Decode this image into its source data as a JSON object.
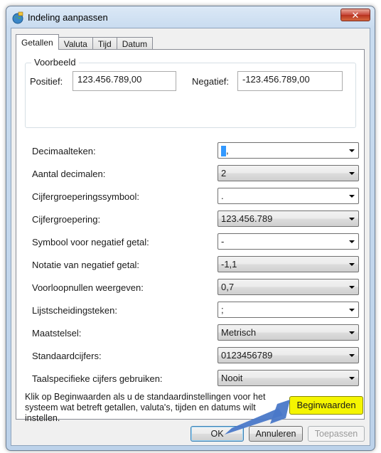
{
  "window": {
    "title": "Indeling aanpassen",
    "close_glyph": "✕"
  },
  "tabs": [
    {
      "label": "Getallen",
      "active": true
    },
    {
      "label": "Valuta",
      "active": false
    },
    {
      "label": "Tijd",
      "active": false
    },
    {
      "label": "Datum",
      "active": false
    }
  ],
  "example": {
    "legend": "Voorbeeld",
    "positive_label": "Positief:",
    "positive_value": "123.456.789,00",
    "negative_label": "Negatief:",
    "negative_value": "-123.456.789,00"
  },
  "settings": [
    {
      "label": "Decimaalteken:",
      "value": ",",
      "filled": false
    },
    {
      "label": "Aantal decimalen:",
      "value": "2",
      "filled": true
    },
    {
      "label": "Cijfergroeperingssymbool:",
      "value": ".",
      "filled": false
    },
    {
      "label": "Cijfergroepering:",
      "value": "123.456.789",
      "filled": true
    },
    {
      "label": "Symbool voor negatief getal:",
      "value": "-",
      "filled": false
    },
    {
      "label": "Notatie van negatief getal:",
      "value": "-1,1",
      "filled": true
    },
    {
      "label": "Voorloopnullen weergeven:",
      "value": "0,7",
      "filled": true
    },
    {
      "label": "Lijstscheidingsteken:",
      "value": ";",
      "filled": false
    },
    {
      "label": "Maatstelsel:",
      "value": "Metrisch",
      "filled": true
    },
    {
      "label": "Standaardcijfers:",
      "value": "0123456789",
      "filled": true
    },
    {
      "label": "Taalspecifieke cijfers gebruiken:",
      "value": "Nooit",
      "filled": true
    }
  ],
  "hint_text": "Klik op Beginwaarden als u de standaardinstellingen voor het systeem wat betreft getallen, valuta's, tijden en datums wilt instellen.",
  "buttons": {
    "reset": "Beginwaarden",
    "ok": "OK",
    "cancel": "Annuleren",
    "apply": "Toepassen"
  },
  "colors": {
    "highlight": "#f5f500",
    "callout_arrow": "#4a78c8"
  }
}
